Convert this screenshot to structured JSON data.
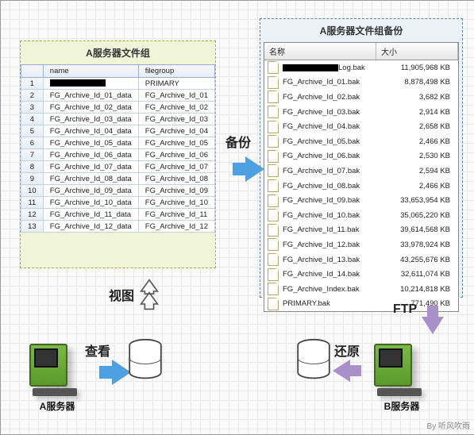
{
  "labels": {
    "backup": "备份",
    "view": "视图",
    "look": "查看",
    "ftp": "FTP",
    "restore": "还原"
  },
  "panel_a": {
    "title": "A服务器文件组",
    "columns": {
      "c1": "name",
      "c2": "filegroup"
    },
    "rows": [
      {
        "n": "1",
        "name": "",
        "redact": true,
        "fg": "PRIMARY"
      },
      {
        "n": "2",
        "name": "FG_Archive_Id_01_data",
        "fg": "FG_Archive_Id_01"
      },
      {
        "n": "3",
        "name": "FG_Archive_Id_02_data",
        "fg": "FG_Archive_Id_02"
      },
      {
        "n": "4",
        "name": "FG_Archive_Id_03_data",
        "fg": "FG_Archive_Id_03"
      },
      {
        "n": "5",
        "name": "FG_Archive_Id_04_data",
        "fg": "FG_Archive_Id_04"
      },
      {
        "n": "6",
        "name": "FG_Archive_Id_05_data",
        "fg": "FG_Archive_Id_05"
      },
      {
        "n": "7",
        "name": "FG_Archive_Id_06_data",
        "fg": "FG_Archive_Id_06"
      },
      {
        "n": "8",
        "name": "FG_Archive_Id_07_data",
        "fg": "FG_Archive_Id_07"
      },
      {
        "n": "9",
        "name": "FG_Archive_Id_08_data",
        "fg": "FG_Archive_Id_08"
      },
      {
        "n": "10",
        "name": "FG_Archive_Id_09_data",
        "fg": "FG_Archive_Id_09"
      },
      {
        "n": "11",
        "name": "FG_Archive_Id_10_data",
        "fg": "FG_Archive_Id_10"
      },
      {
        "n": "12",
        "name": "FG_Archive_Id_11_data",
        "fg": "FG_Archive_Id_11"
      },
      {
        "n": "13",
        "name": "FG_Archive_Id_12_data",
        "fg": "FG_Archive_Id_12"
      }
    ]
  },
  "panel_b": {
    "title": "A服务器文件组备份",
    "columns": {
      "name": "名称",
      "size": "大小"
    },
    "rows": [
      {
        "name": "Log.bak",
        "redact": true,
        "size": "11,905,968 KB"
      },
      {
        "name": "FG_Archive_Id_01.bak",
        "size": "8,878,498 KB"
      },
      {
        "name": "FG_Archive_Id_02.bak",
        "size": "3,682 KB"
      },
      {
        "name": "FG_Archive_Id_03.bak",
        "size": "2,914 KB"
      },
      {
        "name": "FG_Archive_Id_04.bak",
        "size": "2,658 KB"
      },
      {
        "name": "FG_Archive_Id_05.bak",
        "size": "2,466 KB"
      },
      {
        "name": "FG_Archive_Id_06.bak",
        "size": "2,530 KB"
      },
      {
        "name": "FG_Archive_Id_07.bak",
        "size": "2,594 KB"
      },
      {
        "name": "FG_Archive_Id_08.bak",
        "size": "2,466 KB"
      },
      {
        "name": "FG_Archive_Id_09.bak",
        "size": "33,653,954 KB"
      },
      {
        "name": "FG_Archive_Id_10.bak",
        "size": "35,065,220 KB"
      },
      {
        "name": "FG_Archive_Id_11.bak",
        "size": "39,614,568 KB"
      },
      {
        "name": "FG_Archive_Id_12.bak",
        "size": "33,978,924 KB"
      },
      {
        "name": "FG_Archive_Id_13.bak",
        "size": "43,255,676 KB"
      },
      {
        "name": "FG_Archive_Id_14.bak",
        "size": "32,611,074 KB"
      },
      {
        "name": "FG_Archive_Index.bak",
        "size": "10,214,818 KB"
      },
      {
        "name": "PRIMARY.bak",
        "size": "771,490 KB"
      }
    ]
  },
  "servers": {
    "a": "A服务器",
    "b": "B服务器"
  },
  "credit": "By 听风吹雨"
}
